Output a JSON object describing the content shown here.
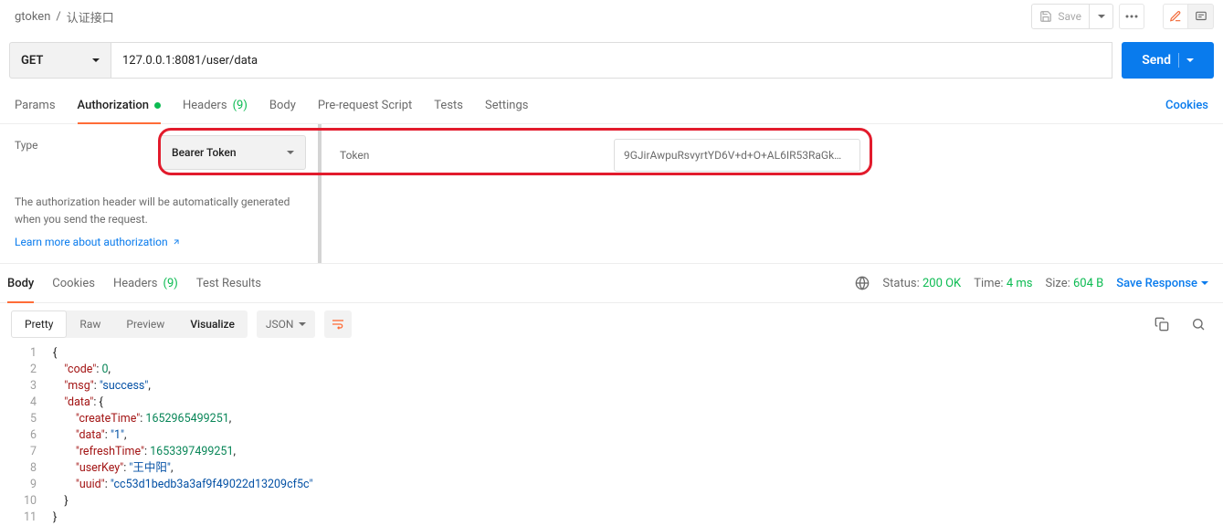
{
  "breadcrumb": {
    "parent": "gtoken",
    "sep": "/",
    "name": "认证接口"
  },
  "top": {
    "save": "Save"
  },
  "request": {
    "method": "GET",
    "url": "127.0.0.1:8081/user/data",
    "send": "Send"
  },
  "tabs": {
    "params": "Params",
    "auth": "Authorization",
    "headers": "Headers",
    "headers_count": "(9)",
    "body": "Body",
    "prerequest": "Pre-request Script",
    "tests": "Tests",
    "settings": "Settings",
    "cookies": "Cookies"
  },
  "auth": {
    "type_label": "Type",
    "type_value": "Bearer Token",
    "desc": "The authorization header will be automatically generated when you send the request.",
    "learn": "Learn more about authorization",
    "token_label": "Token",
    "token_value": "9GJirAwpuRsvyrtYD6V+d+O+AL6IR53RaGk…"
  },
  "resp_tabs": {
    "body": "Body",
    "cookies": "Cookies",
    "headers": "Headers",
    "headers_count": "(9)",
    "test_results": "Test Results"
  },
  "status": {
    "status_label": "Status:",
    "status_value": "200 OK",
    "time_label": "Time:",
    "time_value": "4 ms",
    "size_label": "Size:",
    "size_value": "604 B",
    "save_response": "Save Response"
  },
  "viewer": {
    "pretty": "Pretty",
    "raw": "Raw",
    "preview": "Preview",
    "visualize": "Visualize",
    "lang": "JSON"
  },
  "json_body": {
    "code": 0,
    "msg": "success",
    "data": {
      "createTime": 1652965499251,
      "data": "1",
      "refreshTime": 1653397499251,
      "userKey": "王中阳",
      "uuid": "cc53d1bedb3a3af9f49022d13209cf5c"
    }
  },
  "code_lines": [
    {
      "indent": 0,
      "tokens": [
        {
          "t": "punc",
          "v": "{"
        }
      ]
    },
    {
      "indent": 1,
      "tokens": [
        {
          "t": "key",
          "v": "\"code\""
        },
        {
          "t": "punc",
          "v": ": "
        },
        {
          "t": "num",
          "v": "0"
        },
        {
          "t": "punc",
          "v": ","
        }
      ]
    },
    {
      "indent": 1,
      "tokens": [
        {
          "t": "key",
          "v": "\"msg\""
        },
        {
          "t": "punc",
          "v": ": "
        },
        {
          "t": "str",
          "v": "\"success\""
        },
        {
          "t": "punc",
          "v": ","
        }
      ]
    },
    {
      "indent": 1,
      "tokens": [
        {
          "t": "key",
          "v": "\"data\""
        },
        {
          "t": "punc",
          "v": ": {"
        }
      ]
    },
    {
      "indent": 2,
      "tokens": [
        {
          "t": "key",
          "v": "\"createTime\""
        },
        {
          "t": "punc",
          "v": ": "
        },
        {
          "t": "num",
          "v": "1652965499251"
        },
        {
          "t": "punc",
          "v": ","
        }
      ]
    },
    {
      "indent": 2,
      "tokens": [
        {
          "t": "key",
          "v": "\"data\""
        },
        {
          "t": "punc",
          "v": ": "
        },
        {
          "t": "str",
          "v": "\"1\""
        },
        {
          "t": "punc",
          "v": ","
        }
      ]
    },
    {
      "indent": 2,
      "tokens": [
        {
          "t": "key",
          "v": "\"refreshTime\""
        },
        {
          "t": "punc",
          "v": ": "
        },
        {
          "t": "num",
          "v": "1653397499251"
        },
        {
          "t": "punc",
          "v": ","
        }
      ]
    },
    {
      "indent": 2,
      "tokens": [
        {
          "t": "key",
          "v": "\"userKey\""
        },
        {
          "t": "punc",
          "v": ": "
        },
        {
          "t": "str",
          "v": "\"王中阳\""
        },
        {
          "t": "punc",
          "v": ","
        }
      ]
    },
    {
      "indent": 2,
      "tokens": [
        {
          "t": "key",
          "v": "\"uuid\""
        },
        {
          "t": "punc",
          "v": ": "
        },
        {
          "t": "str",
          "v": "\"cc53d1bedb3a3af9f49022d13209cf5c\""
        }
      ]
    },
    {
      "indent": 1,
      "tokens": [
        {
          "t": "punc",
          "v": "}"
        }
      ]
    },
    {
      "indent": 0,
      "tokens": [
        {
          "t": "punc",
          "v": "}"
        }
      ]
    }
  ]
}
